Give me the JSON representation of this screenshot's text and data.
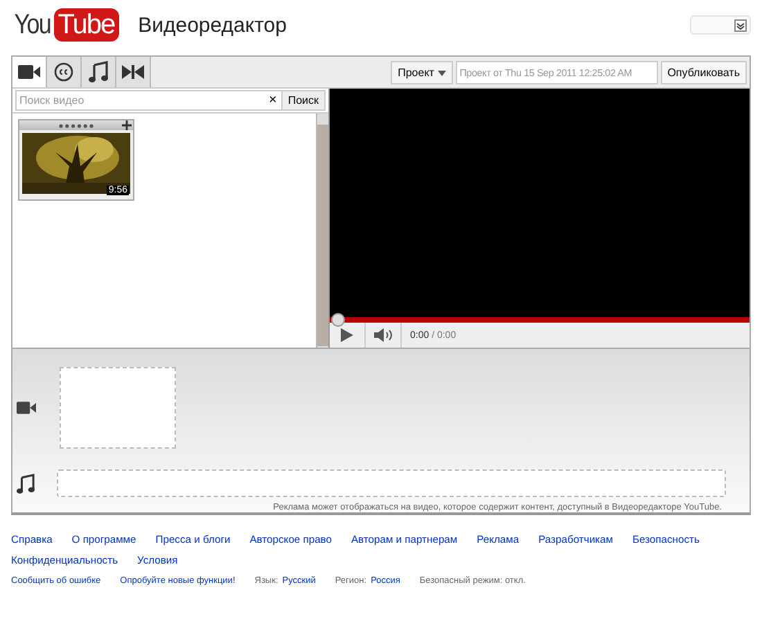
{
  "header": {
    "logo": {
      "you": "You",
      "tube": "Tube"
    },
    "title": "Видеоредактор"
  },
  "tabs": [
    {
      "kind": "camera",
      "selected": true
    },
    {
      "kind": "captions",
      "selected": false
    },
    {
      "kind": "music",
      "selected": false
    },
    {
      "kind": "transition",
      "selected": false
    }
  ],
  "project": {
    "menu": "Проект",
    "placeholder": "Проект от Thu 15 Sep 2011 12:25:02 AM",
    "publish": "Опубликовать"
  },
  "search": {
    "placeholder": "Поиск видео",
    "clear": "×",
    "button": "Поиск"
  },
  "clips": [
    {
      "duration": "9:56"
    }
  ],
  "player": {
    "level": 1,
    "time": "0:00",
    "total": "/ 0:00"
  },
  "timeline": {
    "notice": "Реклама может отображаться на видео, которое содержит контент, доступный в Видеоредакторе YouTube."
  },
  "footer": {
    "links": [
      "Справка",
      "О программе",
      "Пресса и блоги",
      "Авторское право",
      "Авторам и партнерам",
      "Реклама",
      "Разработчикам",
      "Безопасность",
      "Конфиденциальность",
      "Условия"
    ],
    "bottom": [
      {
        "kind": "link",
        "text": "Сообщить об ошибке"
      },
      {
        "kind": "link",
        "text": "Опробуйте новые функции!"
      },
      {
        "kind": "setting",
        "label": "Язык:",
        "value": "Русский"
      },
      {
        "kind": "setting",
        "label": "Регион:",
        "value": "Россия"
      },
      {
        "kind": "plain",
        "text": "Безопасный режим: откл."
      }
    ]
  }
}
